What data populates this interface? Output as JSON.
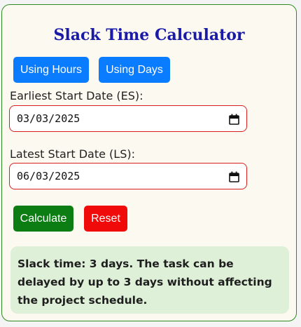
{
  "title": "Slack Time Calculator",
  "mode_buttons": {
    "hours": "Using Hours",
    "days": "Using Days"
  },
  "es": {
    "label": "Earliest Start Date (ES):",
    "value": "03/03/2025",
    "icon": "calendar-icon"
  },
  "ls": {
    "label": "Latest Start Date (LS):",
    "value": "06/03/2025",
    "icon": "calendar-icon"
  },
  "actions": {
    "calculate": "Calculate",
    "reset": "Reset"
  },
  "result": {
    "text": "Slack time: 3 days. The task can be delayed by up to 3 days without affecting the project schedule."
  },
  "colors": {
    "primary_blue": "#0a7cff",
    "calculate_green": "#0b7d13",
    "reset_red": "#f00a0a",
    "title_blue": "#1a1aa8",
    "card_border_green": "#2e8b1f",
    "input_border_red": "#d82020",
    "result_bg": "#dff0d8"
  }
}
